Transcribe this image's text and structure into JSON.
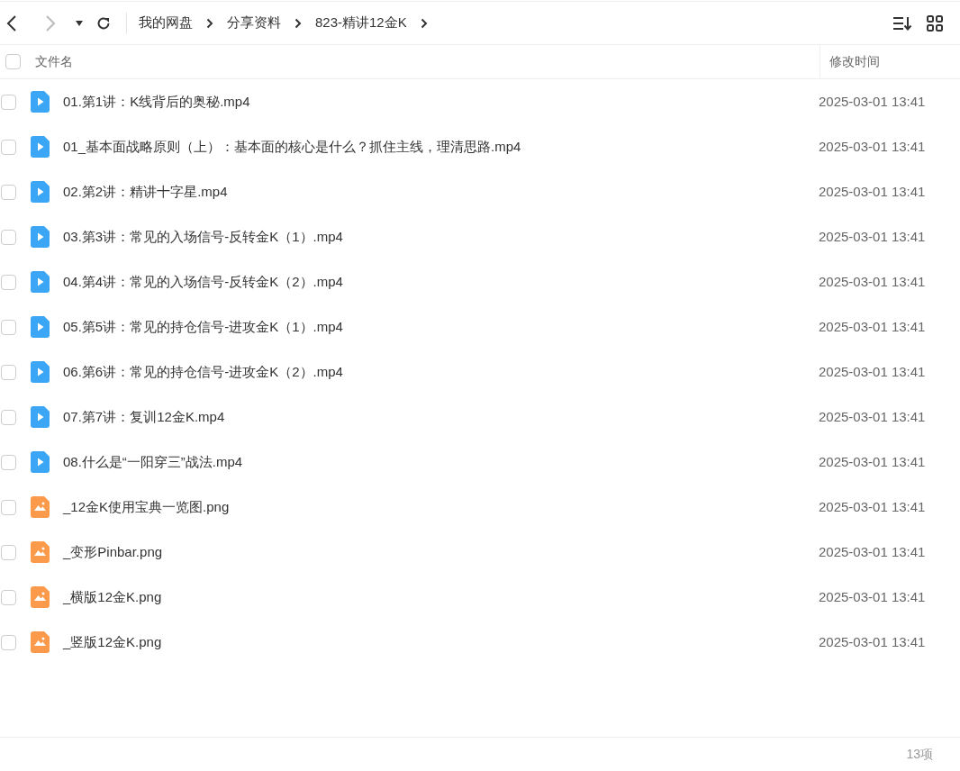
{
  "breadcrumb": [
    {
      "label": "我的网盘"
    },
    {
      "label": "分享资料"
    },
    {
      "label": "823-精讲12金K"
    }
  ],
  "table": {
    "columns": [
      "文件名",
      "修改时间"
    ],
    "all_checked": false,
    "rows": [
      {
        "name": "01.第1讲：K线背后的奥秘.mp4",
        "kind": "video",
        "checked": false,
        "modified": "2025-03-01 13:41"
      },
      {
        "name": "01_基本面战略原则（上）：基本面的核心是什么？抓住主线，理清思路.mp4",
        "kind": "video",
        "checked": false,
        "modified": "2025-03-01 13:41"
      },
      {
        "name": "02.第2讲：精讲十字星.mp4",
        "kind": "video",
        "checked": false,
        "modified": "2025-03-01 13:41"
      },
      {
        "name": "03.第3讲：常见的入场信号-反转金K（1）.mp4",
        "kind": "video",
        "checked": false,
        "modified": "2025-03-01 13:41"
      },
      {
        "name": "04.第4讲：常见的入场信号-反转金K（2）.mp4",
        "kind": "video",
        "checked": false,
        "modified": "2025-03-01 13:41"
      },
      {
        "name": "05.第5讲：常见的持仓信号-进攻金K（1）.mp4",
        "kind": "video",
        "checked": false,
        "modified": "2025-03-01 13:41"
      },
      {
        "name": "06.第6讲：常见的持仓信号-进攻金K（2）.mp4",
        "kind": "video",
        "checked": false,
        "modified": "2025-03-01 13:41"
      },
      {
        "name": "07.第7讲：复训12金K.mp4",
        "kind": "video",
        "checked": false,
        "modified": "2025-03-01 13:41"
      },
      {
        "name": "08.什么是“一阳穿三”战法.mp4",
        "kind": "video",
        "checked": false,
        "modified": "2025-03-01 13:41"
      },
      {
        "name": "_12金K使用宝典一览图.png",
        "kind": "image",
        "checked": false,
        "modified": "2025-03-01 13:41"
      },
      {
        "name": "_变形Pinbar.png",
        "kind": "image",
        "checked": false,
        "modified": "2025-03-01 13:41"
      },
      {
        "name": "_横版12金K.png",
        "kind": "image",
        "checked": false,
        "modified": "2025-03-01 13:41"
      },
      {
        "name": "_竖版12金K.png",
        "kind": "image",
        "checked": false,
        "modified": "2025-03-01 13:41"
      }
    ]
  },
  "status_bar": {
    "count": "13项"
  }
}
